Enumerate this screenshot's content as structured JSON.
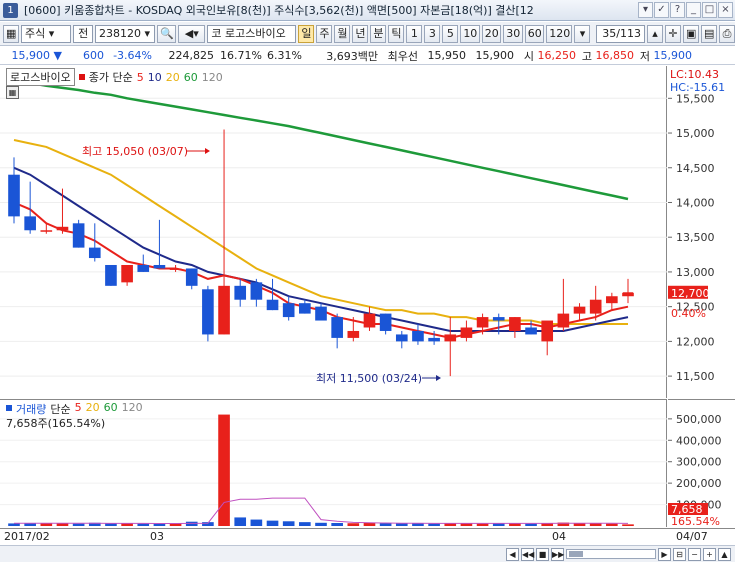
{
  "window": {
    "number": "1",
    "title": "[0600] 키움종합차트 - KOSDAQ 외국인보유[8(천)] 주식수[3,562(천)] 액면[500] 자본금[18(억)] 결산[12"
  },
  "toolbar": {
    "market": "주식",
    "code_label": "전",
    "code": "238120",
    "stock_name": "로고스바이오",
    "stock_prefix": "코",
    "periods": [
      "일",
      "주",
      "월",
      "년",
      "분",
      "틱"
    ],
    "active_period": "일",
    "intervals": [
      "1",
      "3",
      "5",
      "10",
      "20",
      "30",
      "60",
      "120"
    ],
    "page": "35/113"
  },
  "quote": {
    "price": "15,900",
    "change": "600",
    "change_pct": "-3.64%",
    "volume": "224,825",
    "ratio1": "16.71%",
    "ratio2": "6.31%",
    "amount": "3,693백만",
    "best_label": "최우선",
    "bid": "15,950",
    "ask": "15,900",
    "open_label": "시",
    "open": "16,250",
    "high_label": "고",
    "high": "16,850",
    "low_label": "저",
    "low": "15,900"
  },
  "price_pane": {
    "name_tag": "로고스바이오",
    "ma_label": "종가 단순",
    "ma_periods": [
      "5",
      "10",
      "20",
      "60",
      "120"
    ],
    "lc": "LC:10.43",
    "hc": "HC:-15.61",
    "high_note": "최고 15,050 (03/07)",
    "low_note": "최저 11,500 (03/24)",
    "price_tag": "12,700",
    "pct_tag": "0.40%"
  },
  "volume_pane": {
    "label": "거래량",
    "ma_label": "단순",
    "ma_periods": [
      "5",
      "20",
      "60",
      "120"
    ],
    "current": "7,658주(165.54%)",
    "vol_tag": "7,658",
    "pct_tag": "165.54%"
  },
  "time_axis": {
    "labels": [
      "2017/02",
      "03",
      "04",
      "04/07"
    ]
  },
  "colors": {
    "up": "#e8211b",
    "down": "#1a55d6",
    "ma5": "#e8211b",
    "ma10": "#1f2a8a",
    "ma20": "#e8b10f",
    "ma60": "#1e9a3a",
    "ma120": "#888888"
  },
  "chart_data": {
    "type": "candlestick",
    "price_axis": {
      "ticks": [
        "15,500",
        "15,000",
        "14,500",
        "14,000",
        "13,500",
        "13,000",
        "12,500",
        "12,000",
        "11,500"
      ],
      "ylim": [
        11300,
        15850
      ]
    },
    "volume_axis": {
      "ticks": [
        "500,000",
        "400,000",
        "300,000",
        "200,000",
        "100,000"
      ],
      "ylim": [
        0,
        560000
      ]
    },
    "candles": [
      {
        "o": 14400,
        "h": 14650,
        "l": 13700,
        "c": 13800
      },
      {
        "o": 13800,
        "h": 14300,
        "l": 13550,
        "c": 13600
      },
      {
        "o": 13600,
        "h": 13700,
        "l": 13550,
        "c": 13600
      },
      {
        "o": 13600,
        "h": 14200,
        "l": 13550,
        "c": 13650
      },
      {
        "o": 13700,
        "h": 13750,
        "l": 13350,
        "c": 13350
      },
      {
        "o": 13350,
        "h": 13700,
        "l": 13150,
        "c": 13200
      },
      {
        "o": 13100,
        "h": 13100,
        "l": 12800,
        "c": 12800
      },
      {
        "o": 12850,
        "h": 13100,
        "l": 12800,
        "c": 13100
      },
      {
        "o": 13100,
        "h": 13250,
        "l": 13000,
        "c": 13000
      },
      {
        "o": 13100,
        "h": 13750,
        "l": 13050,
        "c": 13050
      },
      {
        "o": 13050,
        "h": 13100,
        "l": 13000,
        "c": 13050
      },
      {
        "o": 13050,
        "h": 13050,
        "l": 12750,
        "c": 12800
      },
      {
        "o": 12750,
        "h": 12800,
        "l": 12000,
        "c": 12100
      },
      {
        "o": 12100,
        "h": 15050,
        "l": 12100,
        "c": 12800
      },
      {
        "o": 12800,
        "h": 12900,
        "l": 12500,
        "c": 12600
      },
      {
        "o": 12850,
        "h": 12900,
        "l": 12500,
        "c": 12600
      },
      {
        "o": 12600,
        "h": 12900,
        "l": 12450,
        "c": 12450
      },
      {
        "o": 12550,
        "h": 12650,
        "l": 12300,
        "c": 12350
      },
      {
        "o": 12550,
        "h": 12600,
        "l": 12400,
        "c": 12400
      },
      {
        "o": 12500,
        "h": 12550,
        "l": 12300,
        "c": 12300
      },
      {
        "o": 12350,
        "h": 12400,
        "l": 11900,
        "c": 12050
      },
      {
        "o": 12050,
        "h": 12350,
        "l": 12000,
        "c": 12150
      },
      {
        "o": 12200,
        "h": 12500,
        "l": 12150,
        "c": 12400
      },
      {
        "o": 12400,
        "h": 12400,
        "l": 12100,
        "c": 12150
      },
      {
        "o": 12100,
        "h": 12150,
        "l": 11900,
        "c": 12000
      },
      {
        "o": 12150,
        "h": 12250,
        "l": 11950,
        "c": 12000
      },
      {
        "o": 12050,
        "h": 12150,
        "l": 11950,
        "c": 12000
      },
      {
        "o": 12000,
        "h": 12350,
        "l": 11500,
        "c": 12100
      },
      {
        "o": 12050,
        "h": 12300,
        "l": 12000,
        "c": 12200
      },
      {
        "o": 12200,
        "h": 12400,
        "l": 12100,
        "c": 12350
      },
      {
        "o": 12350,
        "h": 12400,
        "l": 12100,
        "c": 12300
      },
      {
        "o": 12150,
        "h": 12350,
        "l": 12050,
        "c": 12350
      },
      {
        "o": 12200,
        "h": 12300,
        "l": 12100,
        "c": 12100
      },
      {
        "o": 12000,
        "h": 12200,
        "l": 11800,
        "c": 12300
      },
      {
        "o": 12200,
        "h": 12900,
        "l": 12150,
        "c": 12400
      },
      {
        "o": 12400,
        "h": 12550,
        "l": 12300,
        "c": 12500
      },
      {
        "o": 12400,
        "h": 12800,
        "l": 12300,
        "c": 12600
      },
      {
        "o": 12550,
        "h": 12700,
        "l": 12450,
        "c": 12650
      },
      {
        "o": 12650,
        "h": 12900,
        "l": 12550,
        "c": 12700
      }
    ],
    "ma": {
      "ma5": [
        14000,
        13900,
        13700,
        13600,
        13550,
        13450,
        13300,
        13150,
        13100,
        13050,
        13050,
        13000,
        12900,
        12950,
        12900,
        12800,
        12700,
        12550,
        12500,
        12450,
        12350,
        12300,
        12250,
        12250,
        12200,
        12150,
        12100,
        12050,
        12100,
        12150,
        12200,
        12250,
        12250,
        12200,
        12250,
        12300,
        12350,
        12450,
        12500
      ],
      "ma10": [
        14500,
        14400,
        14250,
        14100,
        13950,
        13800,
        13650,
        13500,
        13350,
        13250,
        13150,
        13100,
        13000,
        12950,
        12900,
        12850,
        12750,
        12650,
        12600,
        12550,
        12500,
        12450,
        12400,
        12350,
        12300,
        12250,
        12200,
        12150,
        12150,
        12150,
        12150,
        12150,
        12150,
        12150,
        12150,
        12200,
        12250,
        12300,
        12350
      ],
      "ma20": [
        14900,
        14850,
        14800,
        14700,
        14600,
        14500,
        14400,
        14250,
        14100,
        13950,
        13800,
        13650,
        13500,
        13350,
        13200,
        13050,
        12950,
        12850,
        12750,
        12650,
        12600,
        12550,
        12500,
        12450,
        12450,
        12400,
        12400,
        12350,
        12350,
        12300,
        12300,
        12300,
        12300,
        12250,
        12250,
        12250,
        12250,
        12250,
        12250
      ],
      "ma60": [
        15750,
        15720,
        15680,
        15650,
        15620,
        15580,
        15550,
        15500,
        15460,
        15420,
        15380,
        15340,
        15300,
        15260,
        15220,
        15180,
        15140,
        15100,
        15050,
        15000,
        14950,
        14900,
        14850,
        14800,
        14750,
        14700,
        14650,
        14600,
        14550,
        14500,
        14450,
        14400,
        14350,
        14300,
        14250,
        14200,
        14150,
        14100,
        14050
      ]
    },
    "volumes": [
      12000,
      14000,
      13000,
      12000,
      11000,
      15000,
      13000,
      12000,
      11000,
      10000,
      12000,
      20000,
      18000,
      520000,
      40000,
      30000,
      25000,
      22000,
      18000,
      15000,
      14000,
      13000,
      14000,
      13000,
      12000,
      12000,
      11000,
      13000,
      12000,
      11000,
      12000,
      13000,
      11000,
      14000,
      16000,
      12000,
      13000,
      11000,
      7658
    ],
    "vol_ma5": [
      13000,
      13000,
      12800,
      12600,
      12400,
      12500,
      12300,
      12200,
      12000,
      11800,
      11600,
      12000,
      13000,
      110000,
      125000,
      125000,
      130000,
      130000,
      130000,
      30000,
      22000,
      17000,
      15000,
      14000,
      13000,
      12500,
      12000,
      12000,
      12000,
      12000,
      12000,
      12000,
      12000,
      12000,
      12500,
      13000,
      13000,
      13000,
      12000
    ]
  }
}
